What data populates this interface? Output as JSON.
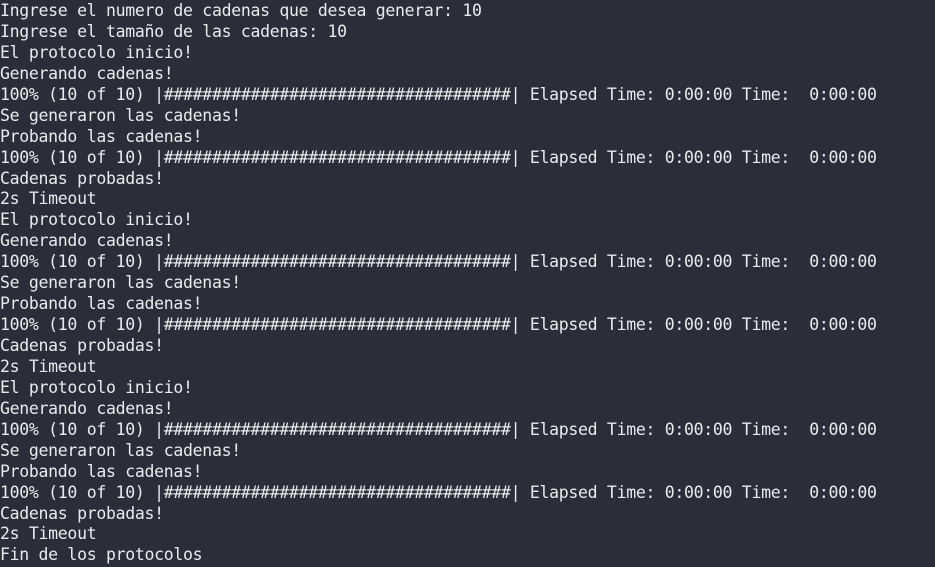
{
  "window": {
    "title": ""
  },
  "terminal": {
    "background": "#2b2d38",
    "foreground": "#e9ebef",
    "lines": [
      "Ingrese el numero de cadenas que desea generar: 10",
      "Ingrese el tamaño de las cadenas: 10",
      "El protocolo inicio!",
      "Generando cadenas!",
      "100% (10 of 10) |####################################| Elapsed Time: 0:00:00 Time:  0:00:00",
      "Se generaron las cadenas!",
      "Probando las cadenas!",
      "100% (10 of 10) |####################################| Elapsed Time: 0:00:00 Time:  0:00:00",
      "Cadenas probadas!",
      "2s Timeout",
      "El protocolo inicio!",
      "Generando cadenas!",
      "100% (10 of 10) |####################################| Elapsed Time: 0:00:00 Time:  0:00:00",
      "Se generaron las cadenas!",
      "Probando las cadenas!",
      "100% (10 of 10) |####################################| Elapsed Time: 0:00:00 Time:  0:00:00",
      "Cadenas probadas!",
      "2s Timeout",
      "El protocolo inicio!",
      "Generando cadenas!",
      "100% (10 of 10) |####################################| Elapsed Time: 0:00:00 Time:  0:00:00",
      "Se generaron las cadenas!",
      "Probando las cadenas!",
      "100% (10 of 10) |####################################| Elapsed Time: 0:00:00 Time:  0:00:00",
      "Cadenas probadas!",
      "2s Timeout",
      "Fin de los protocolos"
    ]
  }
}
